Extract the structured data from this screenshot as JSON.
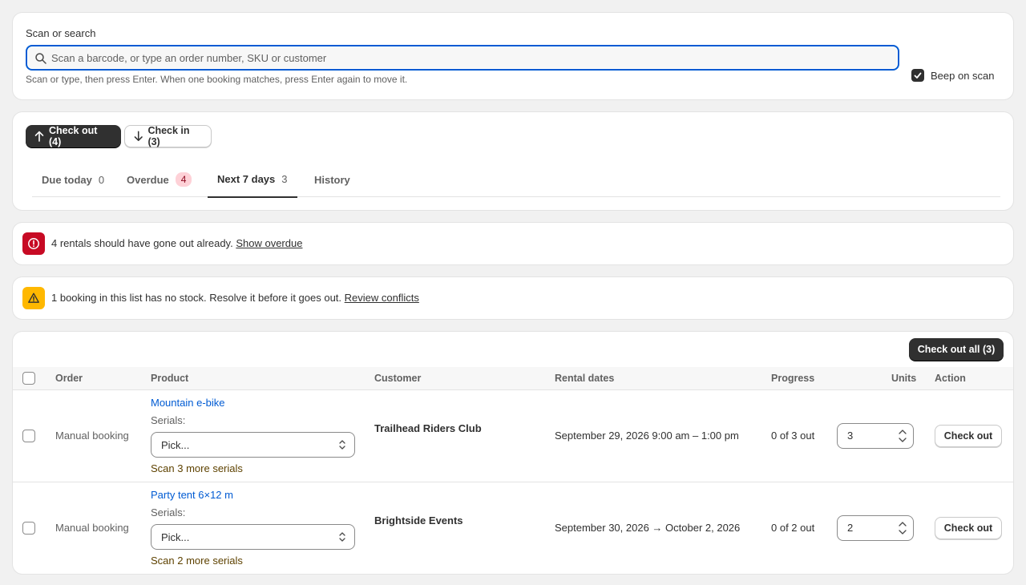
{
  "search": {
    "label": "Scan or search",
    "placeholder": "Scan a barcode, or type an order number, SKU or customer",
    "value": "",
    "help": "Scan or type, then press Enter. When one booking matches, press Enter again to move it.",
    "beep_label": "Beep on scan",
    "beep_checked": true
  },
  "mode": {
    "checkout_label": "Check out (4)",
    "checkin_label": "Check in (3)"
  },
  "tabs": [
    {
      "label": "Due today",
      "count": "0"
    },
    {
      "label": "Overdue",
      "count": "4"
    },
    {
      "label": "Next 7 days",
      "count": "3"
    },
    {
      "label": "History",
      "count": ""
    }
  ],
  "banners": {
    "overdue": {
      "text": "4 rentals should have gone out already.",
      "link": "Show overdue"
    },
    "conflict": {
      "text": "1 booking in this list has no stock. Resolve it before it goes out.",
      "link": "Review conflicts"
    }
  },
  "table": {
    "bulk_action": "Check out all (3)",
    "headers": {
      "order": "Order",
      "product": "Product",
      "customer": "Customer",
      "rental_dates": "Rental dates",
      "progress": "Progress",
      "units": "Units",
      "action": "Action"
    },
    "rows": [
      {
        "order": "Manual booking",
        "product": "Mountain e-bike",
        "serials_label": "Serials:",
        "serials_select": "Pick...",
        "scan_more": "Scan 3 more serials",
        "customer": "Trailhead Riders Club",
        "dates": "September 29, 2026 9:00 am – 1:00 pm",
        "progress": "0 of 3 out",
        "units": "3",
        "action": "Check out"
      },
      {
        "order": "Manual booking",
        "product": "Party tent 6×12 m",
        "serials_label": "Serials:",
        "serials_select": "Pick...",
        "scan_more": "Scan 2 more serials",
        "customer": "Brightside Events",
        "dates": "September 30, 2026 → October 2, 2026",
        "progress": "0 of 2 out",
        "units": "2",
        "action": "Check out"
      }
    ]
  },
  "colors": {
    "primary_button": "#303030",
    "focus_ring": "#005bd3",
    "link": "#005bd3",
    "critical": "#c70a24",
    "warning": "#ffb800",
    "overdue_pill_bg": "#fed1d7"
  }
}
